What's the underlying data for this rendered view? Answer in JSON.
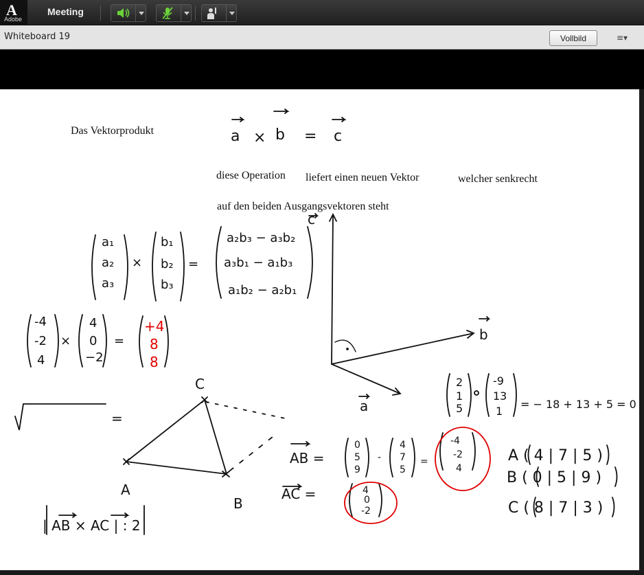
{
  "app": {
    "logo_letter": "A",
    "logo_text": "Adobe",
    "menu": "Meeting"
  },
  "pod": {
    "title": "Whiteboard 19",
    "fullscreen_label": "Vollbild",
    "menu_glyph": "≡▾"
  },
  "whiteboard": {
    "text_boxes": [
      "Das Vektorprodukt",
      "diese Operation",
      "liefert einen neuen Vektor",
      "welcher senkrecht",
      "auf den beiden Ausgangsvektoren steht"
    ],
    "handwriting": {
      "eq_main": [
        "a",
        "×",
        "b",
        "=",
        "c"
      ],
      "general_a": [
        "a₁",
        "a₂",
        "a₃"
      ],
      "general_b": [
        "b₁",
        "b₂",
        "b₃"
      ],
      "general_result": [
        "a₂b₃ − a₃b₂",
        "a₃b₁ − a₁b₃",
        "a₁b₂ − a₂b₁"
      ],
      "ex1_v1": [
        "-4",
        "-2",
        "4"
      ],
      "ex1_v2": [
        "4",
        "0",
        "−2"
      ],
      "ex1_result": [
        "+4",
        "8",
        "8"
      ],
      "axis_labels": [
        "c",
        "b",
        "a"
      ],
      "dot_v1": [
        "2",
        "1",
        "5"
      ],
      "dot_v2": [
        "-9",
        "13",
        "1"
      ],
      "dot_result": "= − 18 + 13 + 5 = 0",
      "points_triangle": [
        "C",
        "A",
        "B"
      ],
      "AB_label": "AB =",
      "AB_v1": [
        "0",
        "5",
        "9"
      ],
      "AB_v2": [
        "4",
        "7",
        "5"
      ],
      "AB_result": [
        "-4",
        "-2",
        "4"
      ],
      "AC_label": "AC =",
      "AC_result": [
        "4",
        "0",
        "-2"
      ],
      "points": [
        "A ( 4 | 7 | 5 )",
        "B ( 0 | 5 | 9 )",
        "C ( 8 | 7 | 3 )"
      ],
      "area_formula": "| AB × AC | : 2",
      "equals_sign": "="
    },
    "colors": {
      "ink": "#111111",
      "highlight": "#e00000"
    }
  }
}
